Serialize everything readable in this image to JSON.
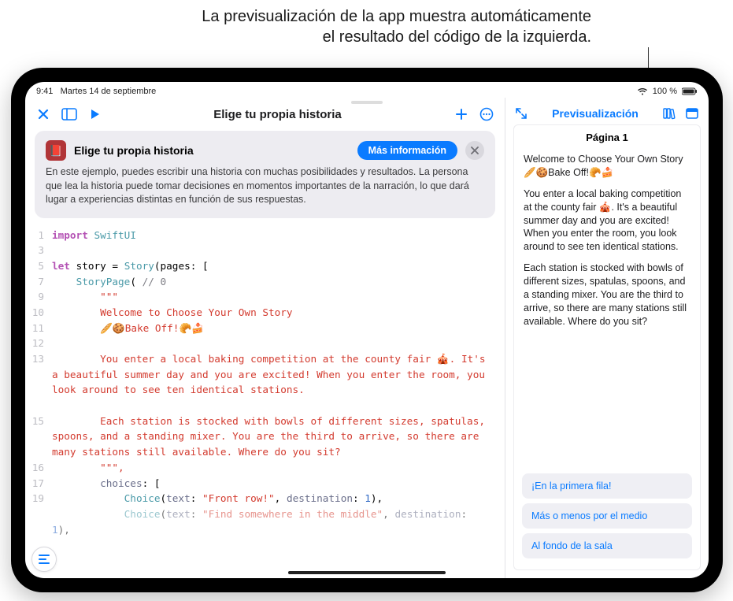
{
  "annotation": {
    "line1": "La previsualización de la app muestra automáticamente",
    "line2": "el resultado del código de la izquierda."
  },
  "status": {
    "time": "9:41",
    "date": "Martes 14 de septiembre",
    "battery": "100 %"
  },
  "editor": {
    "title": "Elige tu propia historia",
    "info": {
      "heading": "Elige tu propia historia",
      "more": "Más información",
      "body": "En este ejemplo, puedes escribir una historia con muchas posibilidades y resultados. La persona que lea la historia puede tomar decisiones en momentos importantes de la narración, lo que dará lugar a experiencias distintas en función de sus respuestas."
    },
    "code": {
      "l1_kw": "import",
      "l1_mod": "SwiftUI",
      "l5_kw": "let",
      "l5_name": "story",
      "l5_eq": " = ",
      "l5_type": "Story",
      "l5_rest": "(pages: [",
      "l7_type": "StoryPage",
      "l7_rest": "( ",
      "l7_cmt": "// 0",
      "l9": "        \"\"\"",
      "l10": "        Welcome to Choose Your Own Story",
      "l11": "        🥖🍪Bake Off!🥐🍰",
      "l13": "        You enter a local baking competition at the county fair 🎪. It's a beautiful summer day and you are excited! When you enter the room, you look around to see ten identical stations.",
      "l15": "        Each station is stocked with bowls of different sizes, spatulas, spoons, and a standing mixer. You are the third to arrive, so there are many stations still available. Where do you sit?",
      "l16": "        \"\"\",",
      "l17_name": "choices",
      "l17_rest": ": [",
      "l19_type": "Choice",
      "l19_txt_k": "text",
      "l19_txt_v": "\"Front row!\"",
      "l19_dst_k": "destination",
      "l19_dst_v": "1",
      "l20_type": "Choice",
      "l20_txt_k": "text",
      "l20_txt_v": "\"Find somewhere in the middle\"",
      "l20_dst_k": "destination",
      "l20_dst_v": "1"
    },
    "line_numbers": [
      "1",
      "3",
      "5",
      "7",
      "9",
      "10",
      "11",
      "12",
      "13",
      "",
      "",
      "15",
      "",
      "",
      "16",
      "17",
      "19",
      ""
    ]
  },
  "preview": {
    "title": "Previsualización",
    "page_label": "Página 1",
    "p1": "Welcome to Choose Your Own Story 🥖🍪Bake Off!🥐🍰",
    "p2": "You enter a local baking competition at the county fair 🎪. It's a beautiful summer day and you are excited! When you enter the room, you look around to see ten identical stations.",
    "p3": "Each station is stocked with bowls of different sizes, spatulas, spoons, and a standing mixer. You are the third to arrive, so there are many stations still available. Where do you sit?",
    "choices": [
      "¡En la primera fila!",
      "Más o menos por el medio",
      "Al fondo de la sala"
    ]
  }
}
